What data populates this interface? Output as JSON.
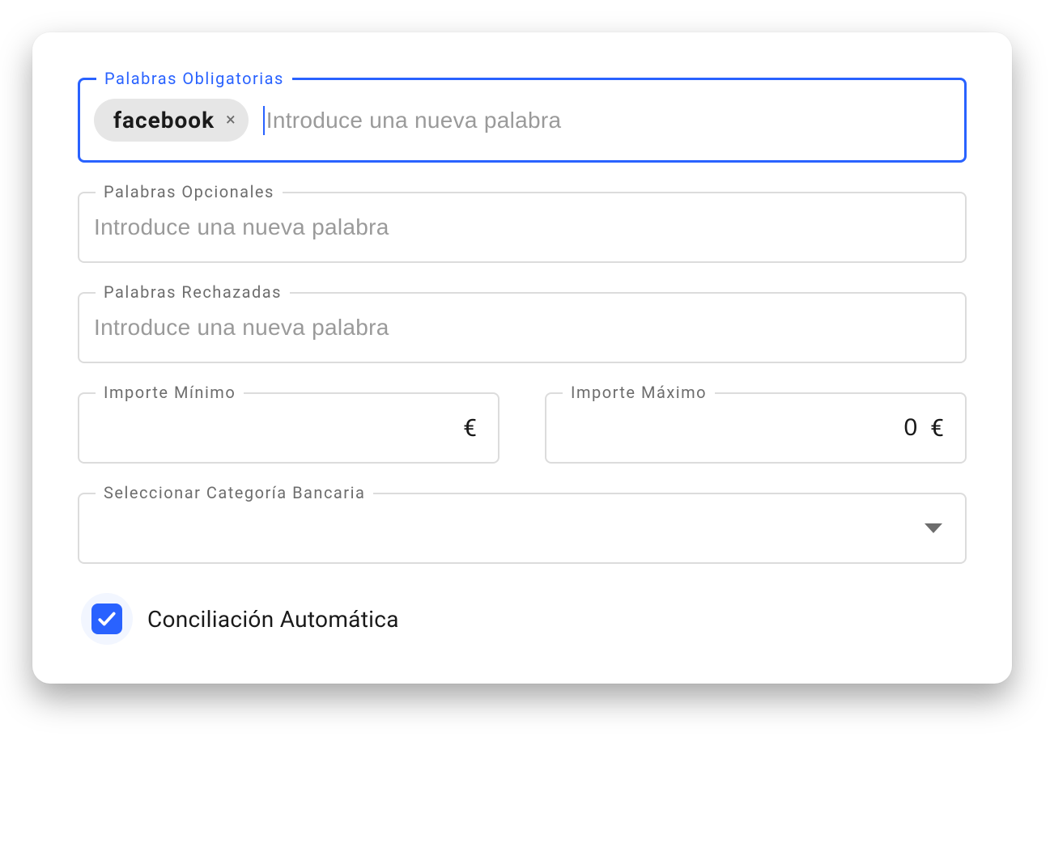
{
  "fields": {
    "mandatory": {
      "legend": "Palabras Obligatorias",
      "chips": [
        "facebook"
      ],
      "placeholder": "Introduce una nueva palabra"
    },
    "optional": {
      "legend": "Palabras Opcionales",
      "placeholder": "Introduce una nueva palabra"
    },
    "rejected": {
      "legend": "Palabras Rechazadas",
      "placeholder": "Introduce una nueva palabra"
    },
    "min_amount": {
      "legend": "Importe Mínimo",
      "value": "",
      "currency": "€"
    },
    "max_amount": {
      "legend": "Importe Máximo",
      "value": "0",
      "currency": "€"
    },
    "bank_category": {
      "legend": "Seleccionar Categoría Bancaria",
      "selected": ""
    }
  },
  "checkbox": {
    "label": "Conciliación Automática",
    "checked": true
  },
  "colors": {
    "accent": "#2962ff",
    "border": "#dcdcdc",
    "muted_text": "#6d6d6d"
  }
}
